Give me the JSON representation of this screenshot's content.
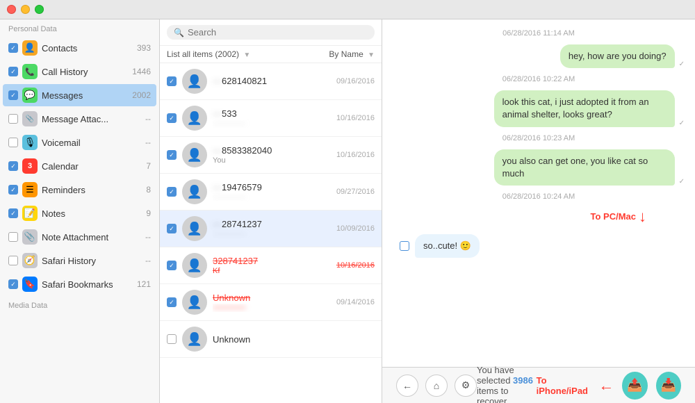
{
  "titlebar": {
    "buttons": [
      "close",
      "minimize",
      "maximize"
    ]
  },
  "sidebar": {
    "personal_section": "Personal Data",
    "media_section": "Media Data",
    "items": [
      {
        "id": "contacts",
        "label": "Contacts",
        "count": "393",
        "icon": "👤",
        "icon_class": "icon-contacts",
        "checked": true
      },
      {
        "id": "callhistory",
        "label": "Call History",
        "count": "1446",
        "icon": "📞",
        "icon_class": "icon-callhistory",
        "checked": true
      },
      {
        "id": "messages",
        "label": "Messages",
        "count": "2002",
        "icon": "💬",
        "icon_class": "icon-messages",
        "checked": true,
        "active": true
      },
      {
        "id": "msgattach",
        "label": "Message Attac...",
        "count": "--",
        "icon": "📎",
        "icon_class": "icon-msgattach",
        "checked": false
      },
      {
        "id": "voicemail",
        "label": "Voicemail",
        "count": "--",
        "icon": "🎙",
        "icon_class": "icon-voicemail",
        "checked": false
      },
      {
        "id": "calendar",
        "label": "Calendar",
        "count": "7",
        "icon": "3",
        "icon_class": "icon-calendar",
        "checked": true
      },
      {
        "id": "reminders",
        "label": "Reminders",
        "count": "8",
        "icon": "☰",
        "icon_class": "icon-reminders",
        "checked": true
      },
      {
        "id": "notes",
        "label": "Notes",
        "count": "9",
        "icon": "📝",
        "icon_class": "icon-notes",
        "checked": true
      },
      {
        "id": "noteattach",
        "label": "Note Attachment",
        "count": "--",
        "icon": "📎",
        "icon_class": "icon-noteattach",
        "checked": false
      },
      {
        "id": "safarihistory",
        "label": "Safari History",
        "count": "--",
        "icon": "🧭",
        "icon_class": "icon-safari",
        "checked": false
      },
      {
        "id": "safaribookmarks",
        "label": "Safari Bookmarks",
        "count": "121",
        "icon": "🔖",
        "icon_class": "icon-safaribookmarks",
        "checked": true
      }
    ]
  },
  "middle": {
    "search_placeholder": "Search",
    "list_label": "List all items (2002)",
    "sort_label": "By Name",
    "contacts": [
      {
        "id": 1,
        "name": "628140821",
        "sub": "",
        "date": "09/16/2016",
        "checked": true,
        "deleted": false,
        "selected": false
      },
      {
        "id": 2,
        "name": "533",
        "sub": "",
        "date": "10/16/2016",
        "checked": true,
        "deleted": false,
        "selected": false
      },
      {
        "id": 3,
        "name": "8583382040",
        "sub": "You",
        "date": "10/16/2016",
        "checked": true,
        "deleted": false,
        "selected": false
      },
      {
        "id": 4,
        "name": "19476579",
        "sub": "",
        "date": "09/27/2016",
        "checked": true,
        "deleted": false,
        "selected": false
      },
      {
        "id": 5,
        "name": "28741237",
        "sub": "",
        "date": "10/09/2016",
        "checked": true,
        "deleted": false,
        "selected": true
      },
      {
        "id": 6,
        "name": "328741237",
        "sub": "Kf",
        "date": "10/16/2016",
        "checked": true,
        "deleted": true,
        "selected": false
      },
      {
        "id": 7,
        "name": "Unknown",
        "sub": "",
        "date": "09/14/2016",
        "checked": true,
        "deleted": true,
        "selected": false
      },
      {
        "id": 8,
        "name": "Unknown",
        "sub": "",
        "date": "",
        "checked": false,
        "deleted": false,
        "selected": false
      }
    ]
  },
  "chat": {
    "messages": [
      {
        "type": "timestamp",
        "text": "06/28/2016 11:14 AM"
      },
      {
        "type": "sent",
        "text": "hey, how are you doing?",
        "check": "✓"
      },
      {
        "type": "timestamp",
        "text": "06/28/2016 10:22 AM"
      },
      {
        "type": "sent",
        "text": "look this cat, i just adopted it from an animal shelter, looks great?",
        "check": "✓"
      },
      {
        "type": "timestamp",
        "text": "06/28/2016 10:23 AM"
      },
      {
        "type": "sent",
        "text": "you also can get one, you like cat so much",
        "check": "✓"
      },
      {
        "type": "timestamp",
        "text": "06/28/2016 10:24 AM"
      },
      {
        "type": "received_selected",
        "text": "so..cute! 🙂"
      }
    ],
    "to_pc_label": "To PC/Mac",
    "to_iphone_label": "To iPhone/iPad"
  },
  "bottom": {
    "status_prefix": "You have selected ",
    "count": "3986",
    "status_suffix": " items to recover",
    "to_iphone_label": "To iPhone/iPad",
    "btn_iphone_icon": "⬆",
    "btn_pc_icon": "⬇"
  }
}
